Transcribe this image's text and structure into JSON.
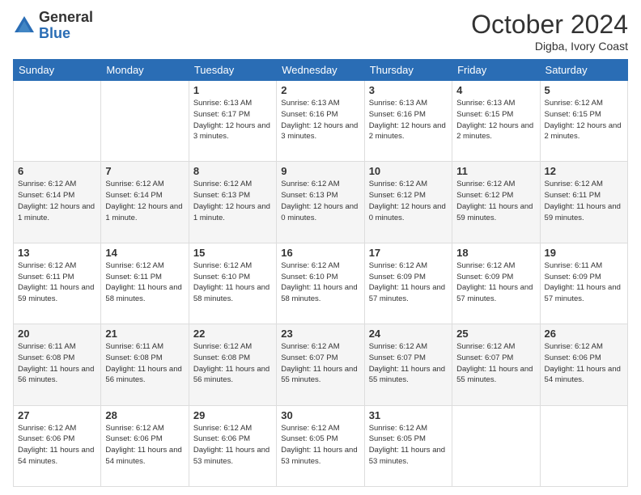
{
  "logo": {
    "general": "General",
    "blue": "Blue"
  },
  "title": "October 2024",
  "subtitle": "Digba, Ivory Coast",
  "days_header": [
    "Sunday",
    "Monday",
    "Tuesday",
    "Wednesday",
    "Thursday",
    "Friday",
    "Saturday"
  ],
  "weeks": [
    [
      {
        "day": "",
        "info": ""
      },
      {
        "day": "",
        "info": ""
      },
      {
        "day": "1",
        "info": "Sunrise: 6:13 AM\nSunset: 6:17 PM\nDaylight: 12 hours and 3 minutes."
      },
      {
        "day": "2",
        "info": "Sunrise: 6:13 AM\nSunset: 6:16 PM\nDaylight: 12 hours and 3 minutes."
      },
      {
        "day": "3",
        "info": "Sunrise: 6:13 AM\nSunset: 6:16 PM\nDaylight: 12 hours and 2 minutes."
      },
      {
        "day": "4",
        "info": "Sunrise: 6:13 AM\nSunset: 6:15 PM\nDaylight: 12 hours and 2 minutes."
      },
      {
        "day": "5",
        "info": "Sunrise: 6:12 AM\nSunset: 6:15 PM\nDaylight: 12 hours and 2 minutes."
      }
    ],
    [
      {
        "day": "6",
        "info": "Sunrise: 6:12 AM\nSunset: 6:14 PM\nDaylight: 12 hours and 1 minute."
      },
      {
        "day": "7",
        "info": "Sunrise: 6:12 AM\nSunset: 6:14 PM\nDaylight: 12 hours and 1 minute."
      },
      {
        "day": "8",
        "info": "Sunrise: 6:12 AM\nSunset: 6:13 PM\nDaylight: 12 hours and 1 minute."
      },
      {
        "day": "9",
        "info": "Sunrise: 6:12 AM\nSunset: 6:13 PM\nDaylight: 12 hours and 0 minutes."
      },
      {
        "day": "10",
        "info": "Sunrise: 6:12 AM\nSunset: 6:12 PM\nDaylight: 12 hours and 0 minutes."
      },
      {
        "day": "11",
        "info": "Sunrise: 6:12 AM\nSunset: 6:12 PM\nDaylight: 11 hours and 59 minutes."
      },
      {
        "day": "12",
        "info": "Sunrise: 6:12 AM\nSunset: 6:11 PM\nDaylight: 11 hours and 59 minutes."
      }
    ],
    [
      {
        "day": "13",
        "info": "Sunrise: 6:12 AM\nSunset: 6:11 PM\nDaylight: 11 hours and 59 minutes."
      },
      {
        "day": "14",
        "info": "Sunrise: 6:12 AM\nSunset: 6:11 PM\nDaylight: 11 hours and 58 minutes."
      },
      {
        "day": "15",
        "info": "Sunrise: 6:12 AM\nSunset: 6:10 PM\nDaylight: 11 hours and 58 minutes."
      },
      {
        "day": "16",
        "info": "Sunrise: 6:12 AM\nSunset: 6:10 PM\nDaylight: 11 hours and 58 minutes."
      },
      {
        "day": "17",
        "info": "Sunrise: 6:12 AM\nSunset: 6:09 PM\nDaylight: 11 hours and 57 minutes."
      },
      {
        "day": "18",
        "info": "Sunrise: 6:12 AM\nSunset: 6:09 PM\nDaylight: 11 hours and 57 minutes."
      },
      {
        "day": "19",
        "info": "Sunrise: 6:11 AM\nSunset: 6:09 PM\nDaylight: 11 hours and 57 minutes."
      }
    ],
    [
      {
        "day": "20",
        "info": "Sunrise: 6:11 AM\nSunset: 6:08 PM\nDaylight: 11 hours and 56 minutes."
      },
      {
        "day": "21",
        "info": "Sunrise: 6:11 AM\nSunset: 6:08 PM\nDaylight: 11 hours and 56 minutes."
      },
      {
        "day": "22",
        "info": "Sunrise: 6:12 AM\nSunset: 6:08 PM\nDaylight: 11 hours and 56 minutes."
      },
      {
        "day": "23",
        "info": "Sunrise: 6:12 AM\nSunset: 6:07 PM\nDaylight: 11 hours and 55 minutes."
      },
      {
        "day": "24",
        "info": "Sunrise: 6:12 AM\nSunset: 6:07 PM\nDaylight: 11 hours and 55 minutes."
      },
      {
        "day": "25",
        "info": "Sunrise: 6:12 AM\nSunset: 6:07 PM\nDaylight: 11 hours and 55 minutes."
      },
      {
        "day": "26",
        "info": "Sunrise: 6:12 AM\nSunset: 6:06 PM\nDaylight: 11 hours and 54 minutes."
      }
    ],
    [
      {
        "day": "27",
        "info": "Sunrise: 6:12 AM\nSunset: 6:06 PM\nDaylight: 11 hours and 54 minutes."
      },
      {
        "day": "28",
        "info": "Sunrise: 6:12 AM\nSunset: 6:06 PM\nDaylight: 11 hours and 54 minutes."
      },
      {
        "day": "29",
        "info": "Sunrise: 6:12 AM\nSunset: 6:06 PM\nDaylight: 11 hours and 53 minutes."
      },
      {
        "day": "30",
        "info": "Sunrise: 6:12 AM\nSunset: 6:05 PM\nDaylight: 11 hours and 53 minutes."
      },
      {
        "day": "31",
        "info": "Sunrise: 6:12 AM\nSunset: 6:05 PM\nDaylight: 11 hours and 53 minutes."
      },
      {
        "day": "",
        "info": ""
      },
      {
        "day": "",
        "info": ""
      }
    ]
  ]
}
